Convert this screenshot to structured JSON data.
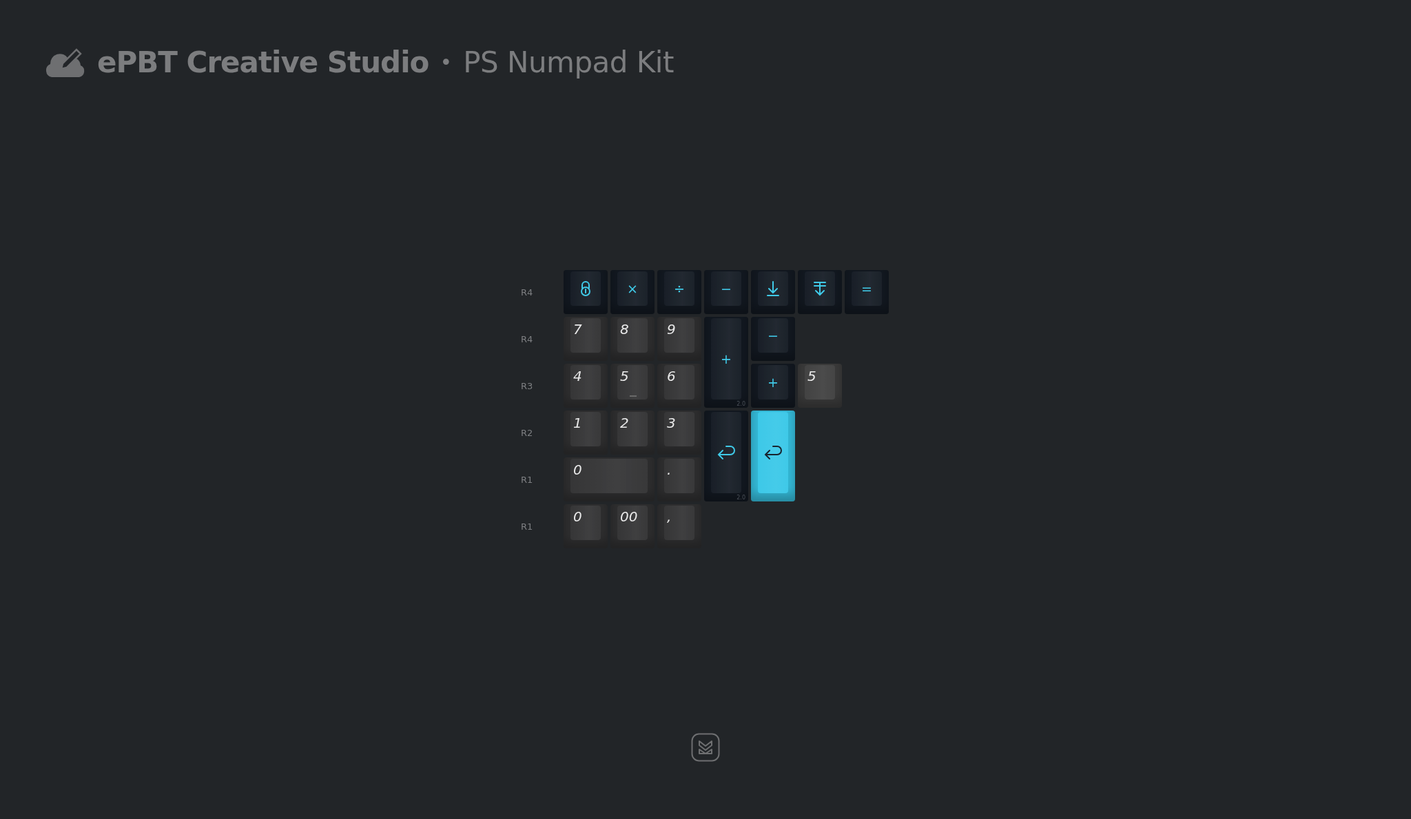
{
  "header": {
    "brand": "ePBT Creative Studio",
    "separator": "•",
    "title": "PS Numpad Kit"
  },
  "row_labels": [
    "R4",
    "R4",
    "R3",
    "R2",
    "R1",
    "R1"
  ],
  "keys": [
    {
      "kind": "icon",
      "color": "#121820",
      "homing": false
    },
    {
      "kind": "text",
      "legend": "×",
      "color": "#121820",
      "homing": false
    },
    {
      "kind": "text",
      "legend": "÷",
      "color": "#121820",
      "homing": false
    },
    {
      "kind": "text",
      "legend": "−",
      "color": "#121820",
      "homing": false
    },
    {
      "kind": "icon",
      "color": "#121820",
      "homing": false
    },
    {
      "kind": "icon",
      "color": "#121820",
      "homing": false
    },
    {
      "kind": "text",
      "legend": "=",
      "color": "#121820",
      "homing": false
    },
    {
      "kind": "alpha",
      "legend": "7",
      "color": "#2e2e2f",
      "homing": false
    },
    {
      "kind": "alpha",
      "legend": "8",
      "color": "#2e2e2f",
      "homing": false
    },
    {
      "kind": "alpha",
      "legend": "9",
      "color": "#2e2e2f",
      "homing": false
    },
    {
      "kind": "text",
      "legend": "+",
      "size": "2.0",
      "color": "#121820",
      "homing": false
    },
    {
      "kind": "text",
      "legend": "−",
      "color": "#121820",
      "homing": false
    },
    {
      "kind": "alpha",
      "legend": "4",
      "color": "#2e2e2f",
      "homing": false
    },
    {
      "kind": "alpha",
      "legend": "5",
      "color": "#2e2e2f",
      "homing": true
    },
    {
      "kind": "alpha",
      "legend": "6",
      "color": "#2e2e2f",
      "homing": false
    },
    {
      "kind": "text",
      "legend": "+",
      "color": "#121820",
      "homing": false
    },
    {
      "kind": "alpha",
      "legend": "5",
      "color": "#3a3a3a",
      "homing": false
    },
    {
      "kind": "alpha",
      "legend": "1",
      "color": "#2e2e2f",
      "homing": false
    },
    {
      "kind": "alpha",
      "legend": "2",
      "color": "#2e2e2f",
      "homing": false
    },
    {
      "kind": "alpha",
      "legend": "3",
      "color": "#2e2e2f",
      "homing": false
    },
    {
      "kind": "icon",
      "size": "2.0",
      "color": "#121820",
      "homing": false
    },
    {
      "kind": "icon",
      "color": "#34b8d6",
      "homing": false
    },
    {
      "kind": "alpha",
      "legend": "0",
      "color": "#2e2e2f",
      "homing": false
    },
    {
      "kind": "alpha",
      "legend": ".",
      "color": "#2e2e2f",
      "homing": false
    },
    {
      "kind": "alpha",
      "legend": "0",
      "color": "#2e2e2f",
      "homing": false
    },
    {
      "kind": "alpha",
      "legend": "00",
      "color": "#2e2e2f",
      "homing": false
    },
    {
      "kind": "alpha",
      "legend": ",",
      "color": "#2e2e2f",
      "homing": false
    }
  ]
}
